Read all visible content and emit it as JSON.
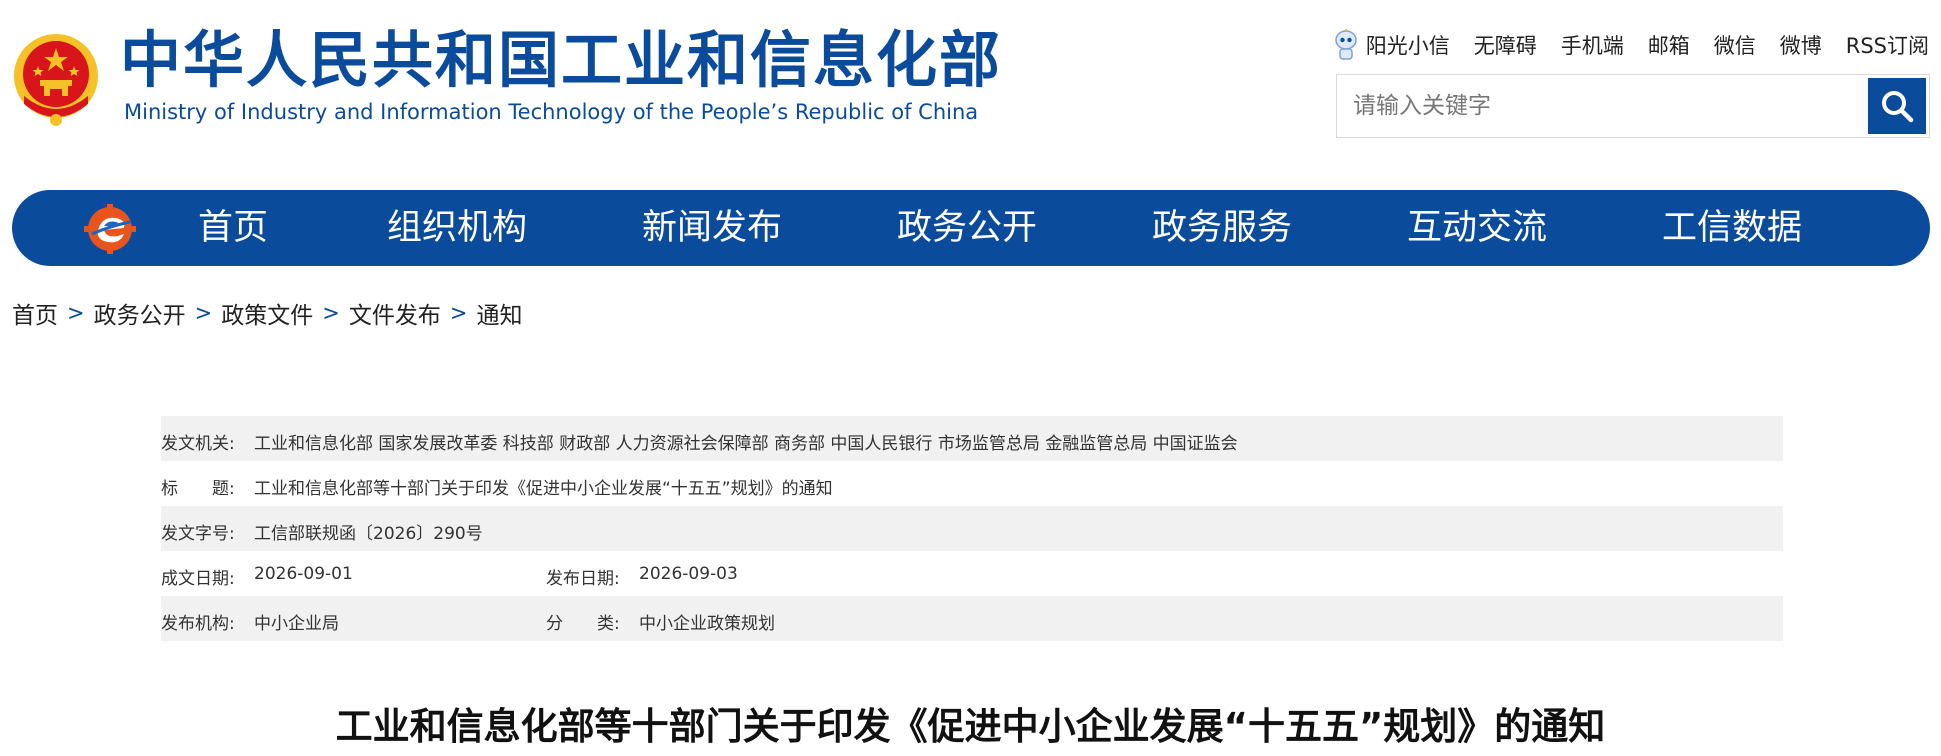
{
  "header": {
    "title_cn": "中华人民共和国工业和信息化部",
    "title_en": "Ministry of Industry and Information Technology of the People’s Republic of China",
    "links": [
      "阳光小信",
      "无障碍",
      "手机端",
      "邮箱",
      "微信",
      "微博",
      "RSS订阅"
    ],
    "search_placeholder": "请输入关键字"
  },
  "nav": {
    "items": [
      "首页",
      "组织机构",
      "新闻发布",
      "政务公开",
      "政务服务",
      "互动交流",
      "工信数据"
    ]
  },
  "breadcrumb": [
    "首页",
    "政务公开",
    "政策文件",
    "文件发布",
    "通知"
  ],
  "breadcrumb_sep": ">",
  "meta": {
    "issuer_label": "发文机关:",
    "issuer": "工业和信息化部 国家发展改革委 科技部 财政部 人力资源社会保障部 商务部 中国人民银行 市场监管总局 金融监管总局 中国证监会",
    "title_label": "标　　题:",
    "title": "工业和信息化部等十部门关于印发《促进中小企业发展“十五五”规划》的通知",
    "doc_no_label": "发文字号:",
    "doc_no": "工信部联规函〔2026〕290号",
    "created_label": "成文日期:",
    "created": "2026-09-01",
    "published_label": "发布日期:",
    "published": "2026-09-03",
    "agency_label": "发布机构:",
    "agency": "中小企业局",
    "category_label": "分　　类:",
    "category": "中小企业政策规划"
  },
  "article": {
    "title": "工业和信息化部等十部门关于印发《促进中小企业发展“十五五”规划》的通知"
  },
  "colors": {
    "brand_blue": "#0a4b9c",
    "emblem_red": "#d7151a",
    "emblem_gold": "#f4c226",
    "row_shade": "#f1f1f1"
  },
  "icons": [
    "national-emblem-icon",
    "robot-mascot-icon",
    "search-icon",
    "nav-logo-icon"
  ]
}
